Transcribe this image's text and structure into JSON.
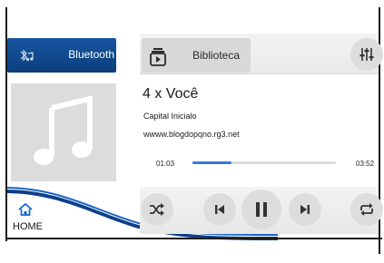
{
  "tabs": {
    "bluetooth_label": "Bluetooth",
    "library_label": "Biblioteca"
  },
  "track": {
    "title": "4 x Você",
    "artist": "Capital Inicialo",
    "album": "wwww.blogdopqno.rg3.net",
    "elapsed": "01:03",
    "total": "03:52",
    "progress": 0.27
  },
  "nav": {
    "home_label": "HOME"
  },
  "icons": {
    "bluetooth": "bluetooth-music-icon",
    "library": "library-icon",
    "equalizer": "equalizer-icon",
    "album_art": "music-note-icon",
    "shuffle": "shuffle-icon",
    "previous": "skip-previous-icon",
    "play_pause": "pause-icon",
    "next": "skip-next-icon",
    "repeat": "repeat-icon",
    "home": "home-icon"
  },
  "colors": {
    "accent": "#1656a0",
    "progress": "#3b78d8"
  }
}
